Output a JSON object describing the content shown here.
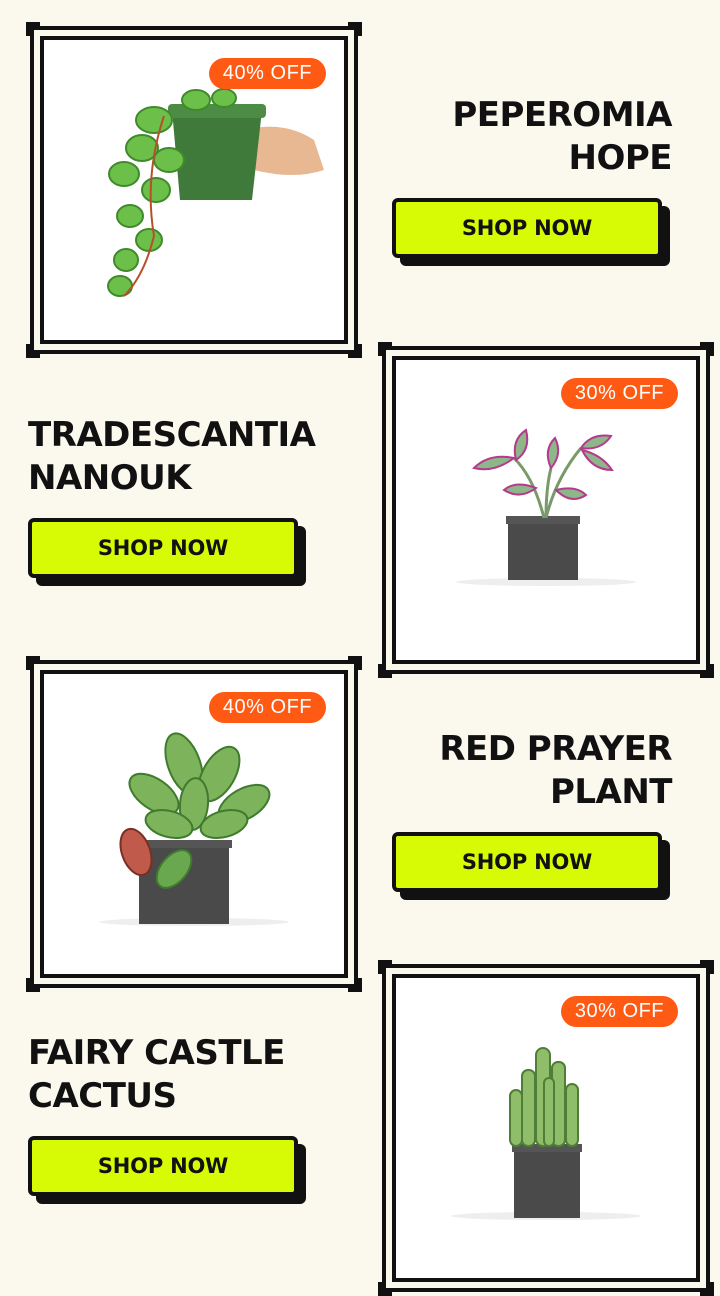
{
  "products": [
    {
      "name_line1": "PEPEROMIA",
      "name_line2": "HOPE",
      "discount": "40% OFF",
      "button_label": "SHOP NOW"
    },
    {
      "name_line1": "TRADESCANTIA",
      "name_line2": "NANOUK",
      "discount": "30% OFF",
      "button_label": "SHOP NOW"
    },
    {
      "name_line1": "RED PRAYER",
      "name_line2": "PLANT",
      "discount": "40% OFF",
      "button_label": "SHOP NOW"
    },
    {
      "name_line1": "FAIRY CASTLE",
      "name_line2": "CACTUS",
      "discount": "30% OFF",
      "button_label": "SHOP NOW"
    }
  ],
  "colors": {
    "background": "#fbf8ee",
    "accent_button": "#d6fb05",
    "badge": "#ff5a14",
    "outline": "#111111"
  }
}
